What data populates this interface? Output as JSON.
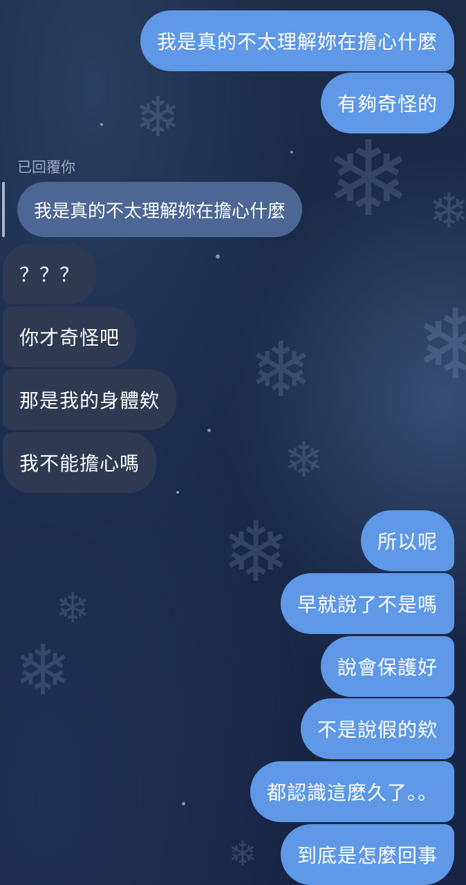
{
  "theme": {
    "outgoing_bubble_color": "#5e98e6",
    "incoming_bubble_color": "#2d3a51",
    "quoted_bubble_color": "#4d6694",
    "background_color": "#1a2a47"
  },
  "chat": {
    "top_outgoing": [
      "我是真的不太理解妳在擔心什麼",
      "有夠奇怪的"
    ],
    "reply": {
      "label": "已回覆你",
      "quoted_text": "我是真的不太理解妳在擔心什麼"
    },
    "incoming": [
      "？？？",
      "你才奇怪吧",
      "那是我的身體欸",
      "我不能擔心嗎"
    ],
    "bottom_outgoing": [
      "所以呢",
      "早就說了不是嗎",
      "說會保護好",
      "不是說假的欸",
      "都認識這麼久了。。",
      "到底是怎麼回事"
    ]
  }
}
